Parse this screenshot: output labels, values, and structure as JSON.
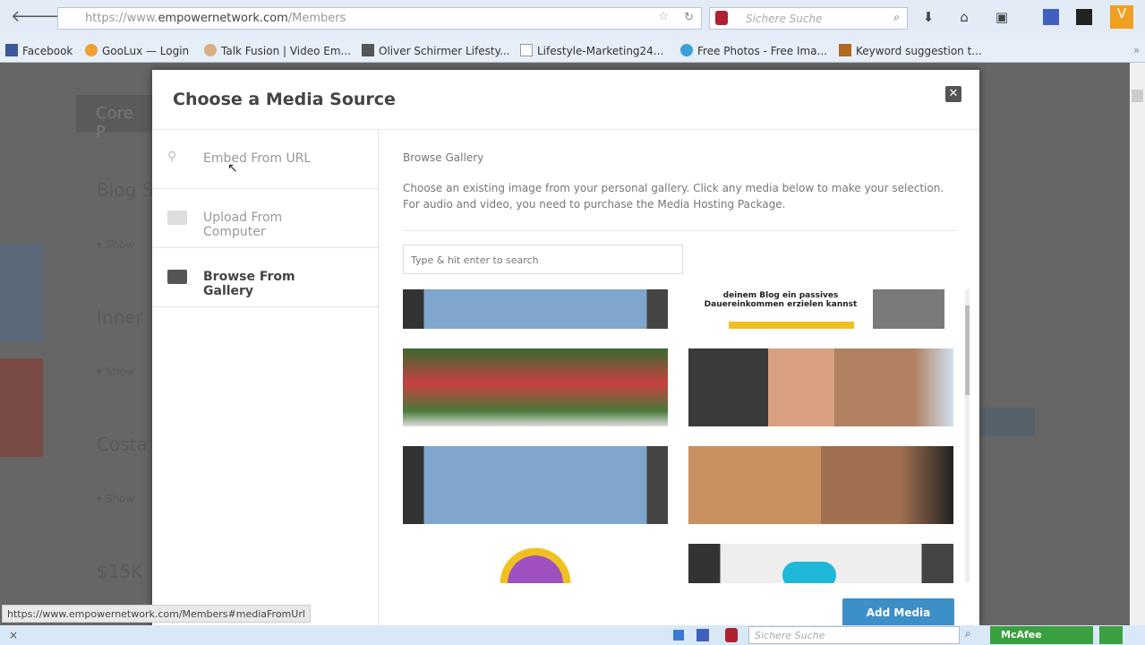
{
  "browser": {
    "url_host": "https://www.",
    "url_domain": "empowernetwork.com",
    "url_path": "/Members",
    "search_placeholder": "Sichere Suche"
  },
  "bookmarks": [
    {
      "label": "Facebook",
      "color": "#3b5998"
    },
    {
      "label": "GooLux — Login",
      "color": "#f0a030"
    },
    {
      "label": "Talk Fusion | Video Em...",
      "color": "#d8b080"
    },
    {
      "label": "Oliver Schirmer Lifesty...",
      "color": "#555"
    },
    {
      "label": "Lifestyle-Marketing24...",
      "color": "#fff"
    },
    {
      "label": "Free Photos - Free Ima...",
      "color": "#3ba0d8"
    },
    {
      "label": "Keyword suggestion t...",
      "color": "#b06a20"
    }
  ],
  "background": {
    "items": [
      "Core P",
      "Blog S",
      "Inner",
      "Costa",
      "$15K",
      "▾ Show",
      "▾ Show",
      "▾ Show"
    ]
  },
  "modal": {
    "title": "Choose a Media Source",
    "close": "✕",
    "sources": [
      {
        "label": "Embed From URL",
        "icon": "link-icon"
      },
      {
        "label": "Upload From Computer",
        "icon": "folder-icon"
      },
      {
        "label": "Browse From Gallery",
        "icon": "folder-icon",
        "active": true
      }
    ],
    "section_title": "Browse Gallery",
    "description": "Choose an existing image from your personal gallery. Click any media below to make your selection. For audio and video, you need to purchase the Media Hosting Package.",
    "search_placeholder": "Type & hit enter to search",
    "gallery_text": [
      "deinem Blog ein passives",
      "Dauereinkommen erzielen kannst"
    ],
    "add_button": "Add Media"
  },
  "status_url": "https://www.empowernetwork.com/Members#mediaFromUrl",
  "addon_bar": {
    "close": "×",
    "search_placeholder": "Sichere Suche",
    "mcafee": "McAfee"
  }
}
